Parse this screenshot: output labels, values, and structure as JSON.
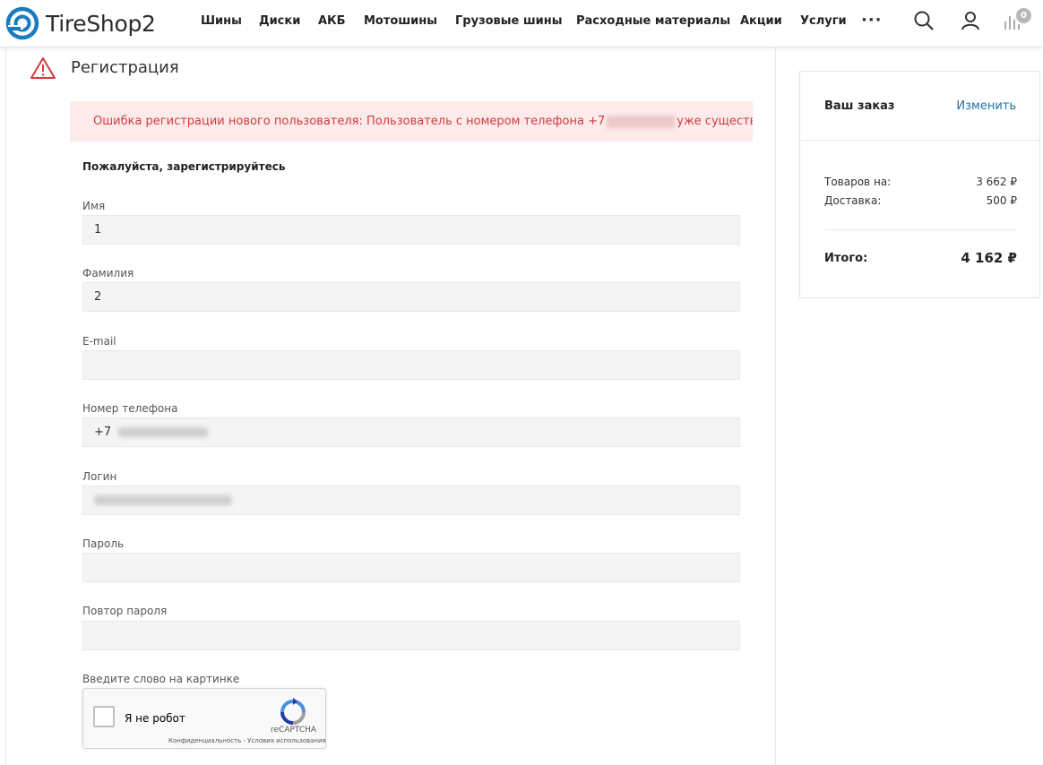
{
  "header": {
    "logo_text": "TireShop2",
    "nav": [
      "Шины",
      "Диски",
      "АКБ",
      "Мотошины",
      "Грузовые шины",
      "Расходные материалы",
      "Акции",
      "Услуги"
    ],
    "more_label": "···",
    "cart_count": "0",
    "icons": [
      "search-icon",
      "user-icon",
      "compare-icon"
    ]
  },
  "page": {
    "title": "Регистрация",
    "alert_prefix": "Ошибка регистрации нового пользователя: Пользователь с номером телефона +7",
    "alert_suffix": "уже существует.",
    "form_heading": "Пожалуйста, зарегистрируйтесь"
  },
  "form": {
    "name_label": "Имя",
    "name_value": "1",
    "surname_label": "Фамилия",
    "surname_value": "2",
    "email_label": "E-mail",
    "email_value": "",
    "phone_label": "Номер телефона",
    "phone_prefix": "+7",
    "login_label": "Логин",
    "password_label": "Пароль",
    "password_repeat_label": "Повтор пароля",
    "captcha_label": "Введите слово на картинке"
  },
  "captcha": {
    "checkbox_label": "Я не робот",
    "brand": "reCAPTCHA",
    "links": "Конфиденциальность - Условия использования"
  },
  "order": {
    "title": "Ваш заказ",
    "edit_label": "Изменить",
    "goods_label": "Товаров на:",
    "goods_value": "3 662 ₽",
    "delivery_label": "Доставка:",
    "delivery_value": "500 ₽",
    "total_label": "Итого:",
    "total_value": "4 162 ₽"
  },
  "colors": {
    "brand": "#1a7bbf",
    "alert_bg": "#fdeaea",
    "alert_text": "#d23c3c",
    "link": "#1f6fa8"
  }
}
